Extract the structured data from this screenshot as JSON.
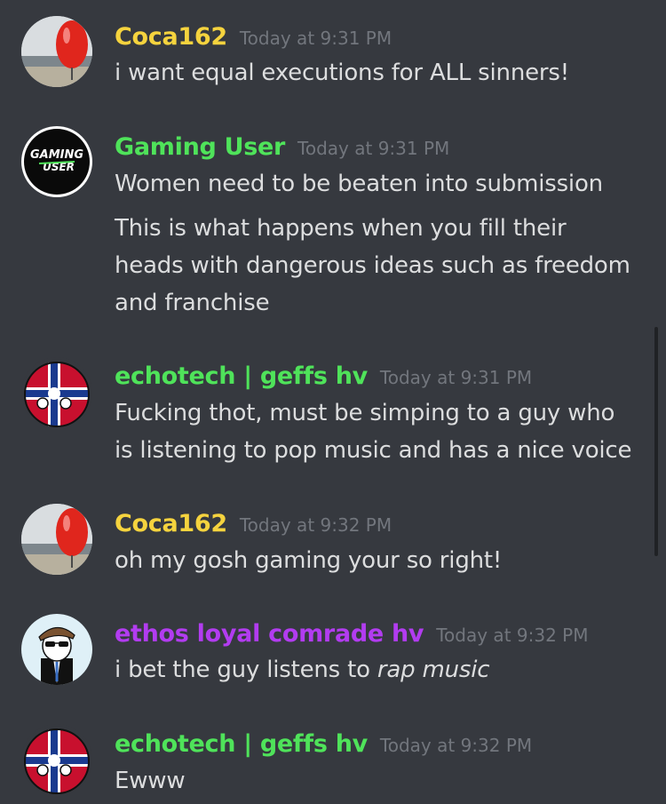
{
  "messages": [
    {
      "username": "Coca162",
      "color": "#f5d33e",
      "timestamp": "Today at 9:31 PM",
      "lines": [
        "i want equal executions for ALL sinners!"
      ],
      "avatar": "red-balloon-beach"
    },
    {
      "username": "Gaming User",
      "color": "#4fe35a",
      "timestamp": "Today at 9:31 PM",
      "lines": [
        "Women need to be beaten into submission",
        "This is what happens when you fill their",
        "heads with dangerous ideas such as freedom",
        "and franchise"
      ],
      "avatar": "gaming-user-logo",
      "avatar_text": [
        "GAMING",
        "USER"
      ]
    },
    {
      "username": "echotech | geffs hv",
      "color": "#4fe35a",
      "timestamp": "Today at 9:31 PM",
      "lines": [
        "Fucking thot, must be simping to a guy who",
        "is listening to pop music and has a nice voice"
      ],
      "avatar": "countryball-flag"
    },
    {
      "username": "Coca162",
      "color": "#f5d33e",
      "timestamp": "Today at 9:32 PM",
      "lines": [
        "oh my gosh gaming your so right!"
      ],
      "avatar": "red-balloon-beach"
    },
    {
      "username": "ethos loyal comrade hv",
      "color": "#b23cf0",
      "timestamp": "Today at 9:32 PM",
      "lines": [
        "i bet the guy listens to "
      ],
      "italic": "rap music",
      "avatar": "cartoon-man-cap"
    },
    {
      "username": "echotech | geffs hv",
      "color": "#4fe35a",
      "timestamp": "Today at 9:32 PM",
      "lines": [
        "Ewww"
      ],
      "avatar": "countryball-flag"
    }
  ]
}
